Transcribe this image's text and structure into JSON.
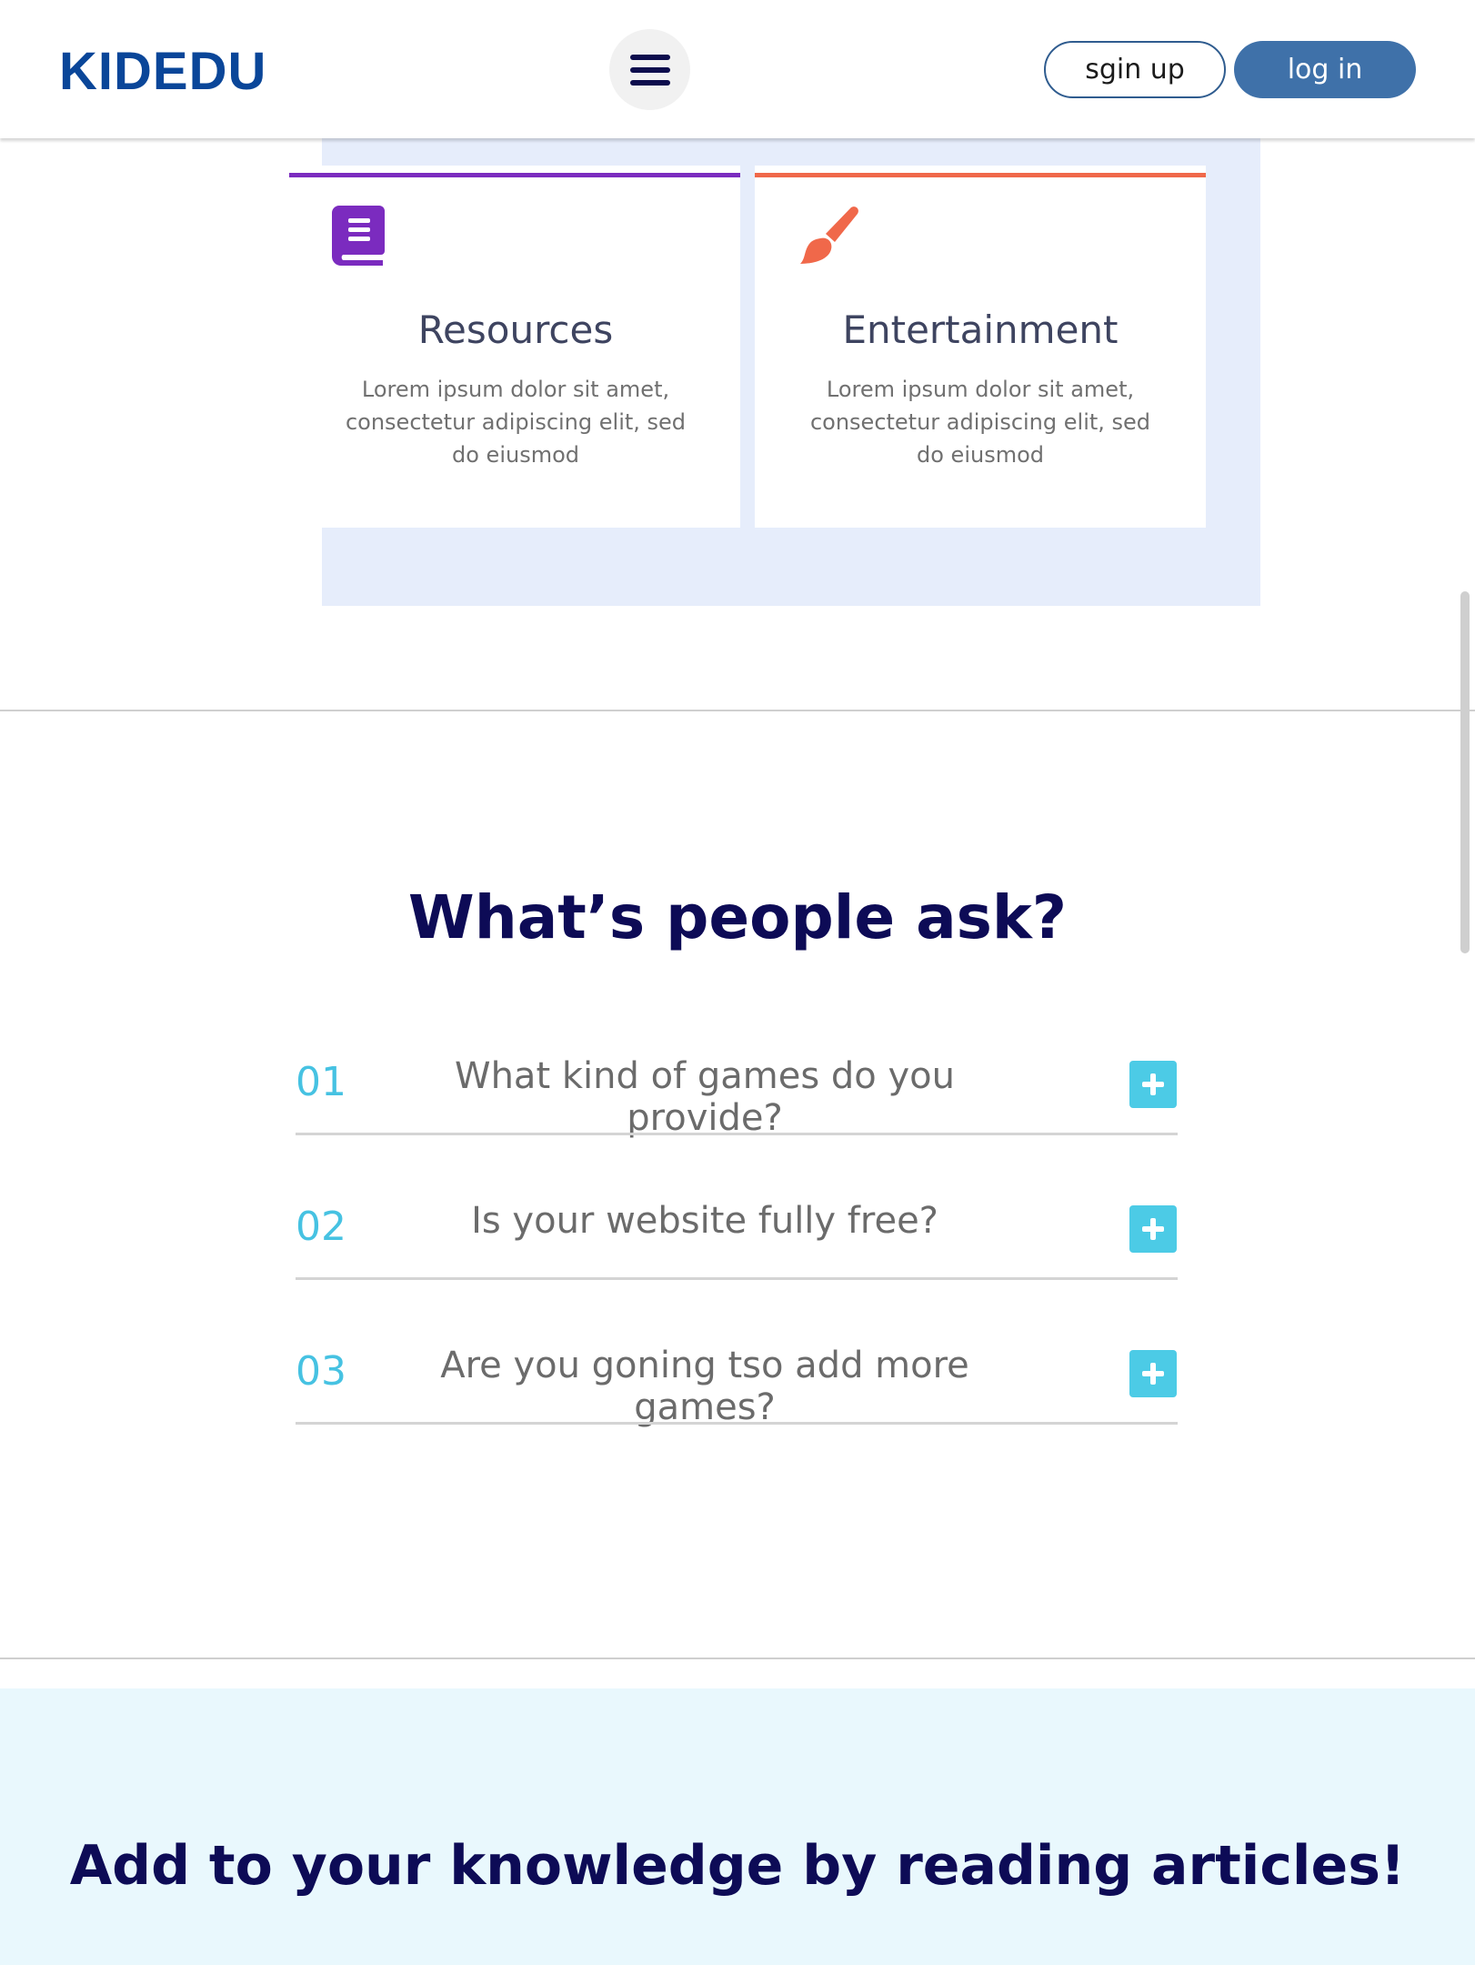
{
  "header": {
    "logo": "KIDEDU",
    "menu_icon": "hamburger-menu-icon",
    "signup_label": "sgin up",
    "login_label": "log in"
  },
  "cards": [
    {
      "icon": "book-icon",
      "icon_color": "#7b2bbf",
      "title": "Resources",
      "text_lines": [
        "Lorem ipsum dolor sit amet,",
        "consectetur adipiscing elit, sed",
        "do eiusmod"
      ]
    },
    {
      "icon": "paintbrush-icon",
      "icon_color": "#f0684a",
      "title": "Entertainment",
      "text_lines": [
        "Lorem ipsum dolor sit amet,",
        "consectetur adipiscing elit, sed",
        "do eiusmod"
      ]
    }
  ],
  "faq": {
    "heading": "What’s people ask?",
    "items": [
      {
        "num": "01",
        "question": "What kind of games do you provide?",
        "icon": "plus-icon"
      },
      {
        "num": "02",
        "question": "Is your website fully free?",
        "icon": "plus-icon"
      },
      {
        "num": "03",
        "question": "Are you goning tso add more games?",
        "icon": "plus-icon"
      }
    ]
  },
  "articles": {
    "title": "Add to your knowledge by reading articles!"
  },
  "colors": {
    "brand": "#0a4699",
    "login_button": "#3f71a9",
    "accent_cyan": "#4ccbe6",
    "heading_navy": "#0d0b56",
    "card_band": "#e6edfb",
    "articles_bg": "#e9f8fd"
  }
}
